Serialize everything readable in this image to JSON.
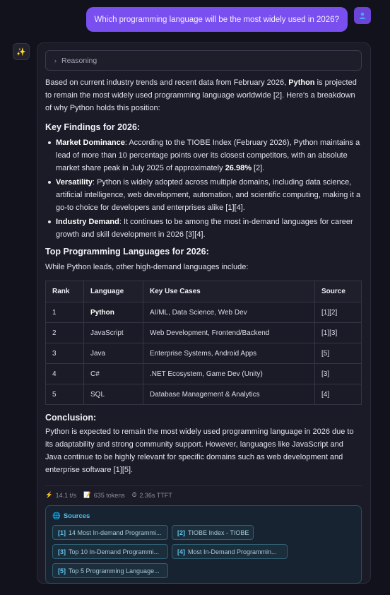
{
  "user": {
    "message": "Which programming language will be the most widely used in 2026?",
    "avatar_icon": "user-icon"
  },
  "assistant": {
    "avatar_icon": "sparkle-icon",
    "reasoning_label": "Reasoning",
    "intro": {
      "pre": "Based on current industry trends and recent data from February 2026, ",
      "bold": "Python",
      "post": " is projected to remain the most widely used programming language worldwide [2]. Here's a breakdown of why Python holds this position:"
    },
    "findings_heading": "Key Findings for 2026:",
    "findings": [
      {
        "title": "Market Dominance",
        "pre": ": According to the TIOBE Index (February 2026), Python maintains a lead of more than 10 percentage points over its closest competitors, with an absolute market share peak in July 2025 of approximately ",
        "bold": "26.98%",
        "post": " [2]."
      },
      {
        "title": "Versatility",
        "pre": ": Python is widely adopted across multiple domains, including data science, artificial intelligence, web development, automation, and scientific computing, making it a go-to choice for developers and enterprises alike [1][4].",
        "bold": "",
        "post": ""
      },
      {
        "title": "Industry Demand",
        "pre": ": It continues to be among the most in-demand languages for career growth and skill development in 2026 [3][4].",
        "bold": "",
        "post": ""
      }
    ],
    "top_heading": "Top Programming Languages for 2026:",
    "top_intro": "While Python leads, other high-demand languages include:",
    "table": {
      "headers": [
        "Rank",
        "Language",
        "Key Use Cases",
        "Source"
      ],
      "rows": [
        [
          "1",
          "Python",
          "AI/ML, Data Science, Web Dev",
          "[1][2]"
        ],
        [
          "2",
          "JavaScript",
          "Web Development, Frontend/Backend",
          "[1][3]"
        ],
        [
          "3",
          "Java",
          "Enterprise Systems, Android Apps",
          "[5]"
        ],
        [
          "4",
          "C#",
          ".NET Ecosystem, Game Dev (Unity)",
          "[3]"
        ],
        [
          "5",
          "SQL",
          "Database Management & Analytics",
          "[4]"
        ]
      ]
    },
    "conclusion_heading": "Conclusion:",
    "conclusion": "Python is expected to remain the most widely used programming language in 2026 due to its adaptability and strong community support. However, languages like JavaScript and Java continue to be highly relevant for specific domains such as web development and enterprise software [1][5].",
    "stats": {
      "speed": "14.1 t/s",
      "tokens": "635 tokens",
      "ttft": "2.36s TTFT"
    },
    "sources_title": "Sources",
    "sources": [
      {
        "num": "[1]",
        "label": "14 Most In-demand Programmi..."
      },
      {
        "num": "[2]",
        "label": "TIOBE Index - TIOBE"
      },
      {
        "num": "[3]",
        "label": "Top 10 In-Demand Programmi..."
      },
      {
        "num": "[4]",
        "label": "Most In-Demand Programmin..."
      },
      {
        "num": "[5]",
        "label": "Top 5 Programming Language..."
      }
    ]
  },
  "colors": {
    "background": "#12121c",
    "user_bubble": "#7a4ff0",
    "card": "#1b1b27",
    "sources_accent": "#53c0e8"
  }
}
